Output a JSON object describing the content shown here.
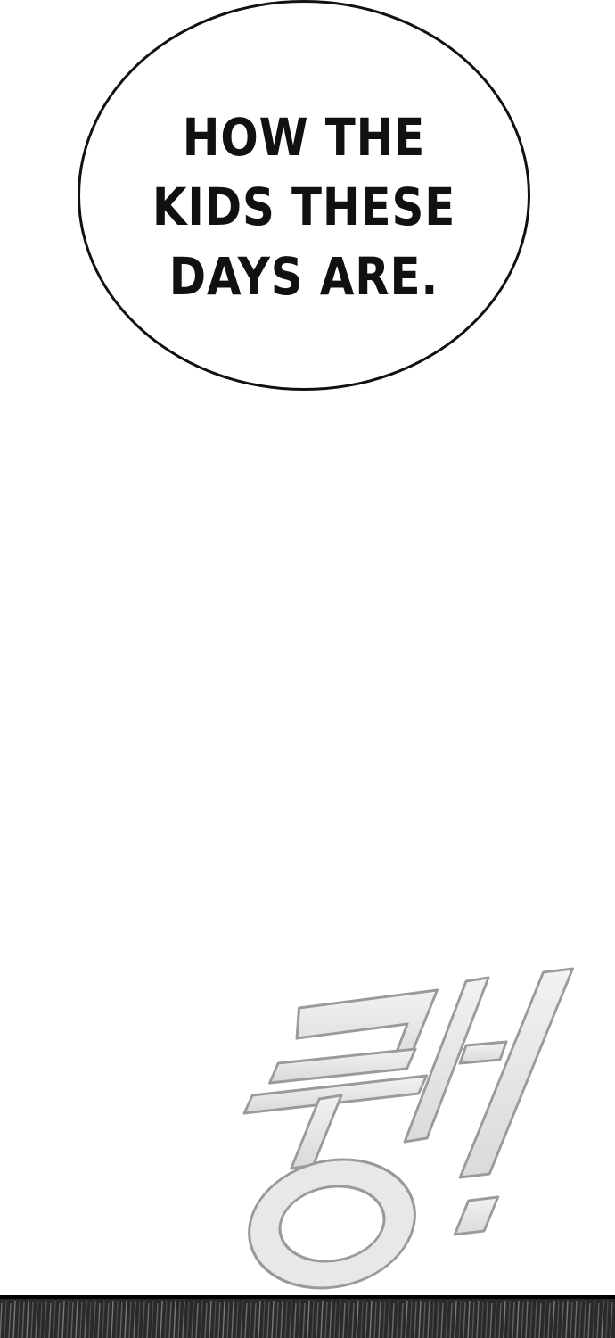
{
  "speech_bubble": {
    "lines": [
      "HOW THE",
      "KIDS THESE",
      "DAYS ARE."
    ]
  },
  "sound_effect": {
    "text": "쾅!"
  },
  "colors": {
    "background": "#ffffff",
    "ink": "#111111",
    "sfx_fill": "#e6e6e6",
    "sfx_outline": "#9a9a9a",
    "strip": "#2a2a2a"
  }
}
